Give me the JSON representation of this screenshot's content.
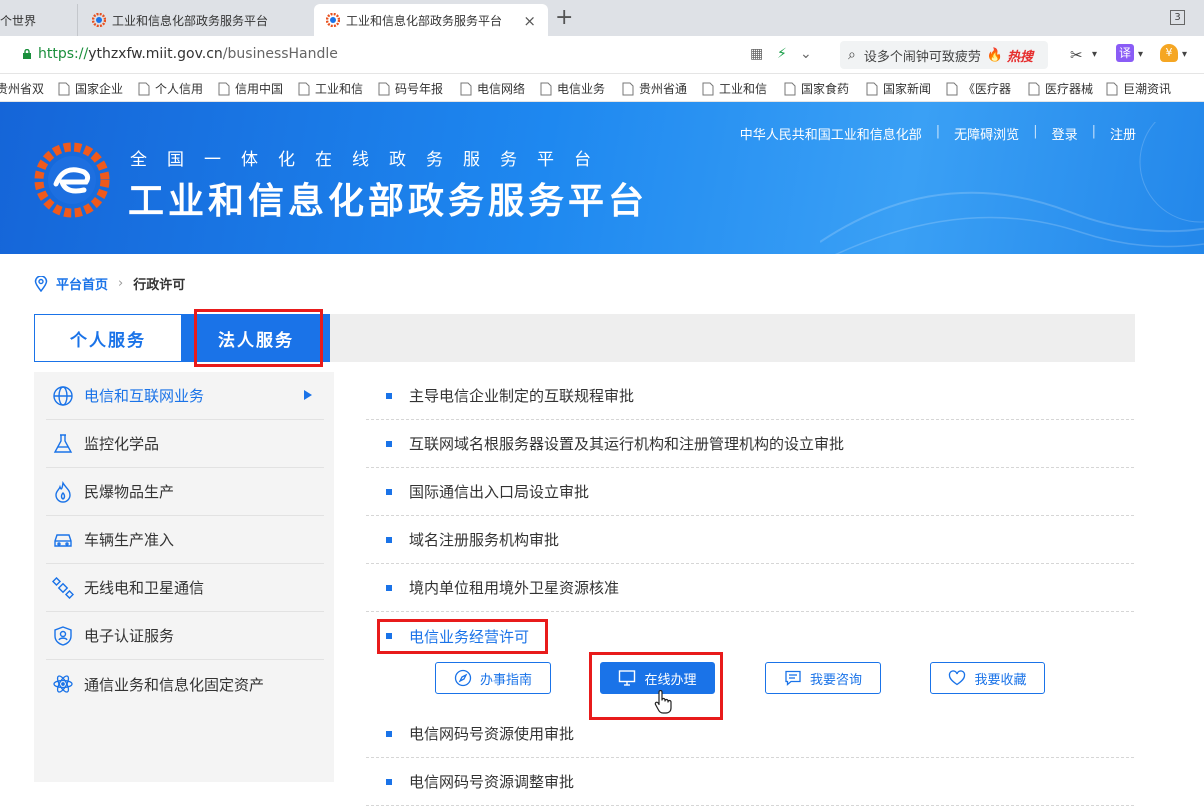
{
  "browser": {
    "tabs": [
      {
        "label": "整个世界"
      },
      {
        "label": "工业和信息化部政务服务平台"
      },
      {
        "label": "工业和信息化部政务服务平台",
        "active": true
      }
    ],
    "close_glyph": "×",
    "new_tab_glyph": "+",
    "tab_count": "3",
    "url_scheme": "https://",
    "url_host": "ythzxfw.miit.gov.cn",
    "url_path": "/businessHandle",
    "search_text": "设多个闹钟可致疲劳",
    "search_hot": "热搜",
    "translate_label": "译",
    "bookmarks": [
      {
        "label": "贵州省双"
      },
      {
        "label": "国家企业"
      },
      {
        "label": "个人信用"
      },
      {
        "label": "信用中国"
      },
      {
        "label": "工业和信"
      },
      {
        "label": "码号年报"
      },
      {
        "label": "电信网络"
      },
      {
        "label": "电信业务"
      },
      {
        "label": "贵州省通"
      },
      {
        "label": "工业和信"
      },
      {
        "label": "国家食药"
      },
      {
        "label": "国家新闻"
      },
      {
        "label": "《医疗器"
      },
      {
        "label": "医疗器械"
      },
      {
        "label": "巨潮资讯"
      }
    ]
  },
  "header": {
    "subtitle": "全国一体化在线政务服务平台",
    "title": "工业和信息化部政务服务平台",
    "links": [
      "中华人民共和国工业和信息化部",
      "无障碍浏览",
      "登录",
      "注册"
    ],
    "link_separator": "|"
  },
  "breadcrumb": {
    "home": "平台首页",
    "separator": "›",
    "current": "行政许可"
  },
  "service_tabs": {
    "personal": "个人服务",
    "legal": "法人服务",
    "selected": "legal"
  },
  "sidebar": {
    "items": [
      {
        "label": "电信和互联网业务",
        "icon": "globe-icon",
        "active": true
      },
      {
        "label": "监控化学品",
        "icon": "flask-icon"
      },
      {
        "label": "民爆物品生产",
        "icon": "flame-icon"
      },
      {
        "label": "车辆生产准入",
        "icon": "car-icon"
      },
      {
        "label": "无线电和卫星通信",
        "icon": "satellite-icon"
      },
      {
        "label": "电子认证服务",
        "icon": "shield-user-icon"
      },
      {
        "label": "通信业务和信息化固定资产",
        "icon": "atom-icon"
      }
    ]
  },
  "list": {
    "items": [
      {
        "label": "主导电信企业制定的互联规程审批"
      },
      {
        "label": "互联网域名根服务器设置及其运行机构和注册管理机构的设立审批"
      },
      {
        "label": "国际通信出入口局设立审批"
      },
      {
        "label": "域名注册服务机构审批"
      },
      {
        "label": "境内单位租用境外卫星资源核准"
      },
      {
        "label": "电信业务经营许可",
        "active": true
      },
      {
        "label": "电信网码号资源使用审批"
      },
      {
        "label": "电信网码号资源调整审批"
      }
    ],
    "actions": {
      "guide": "办事指南",
      "online": "在线办理",
      "consult": "我要咨询",
      "favorite": "我要收藏"
    }
  },
  "colors": {
    "primary": "#1a73e8",
    "highlight_box": "#e81b1b",
    "header_bg": "#1e88f0"
  }
}
